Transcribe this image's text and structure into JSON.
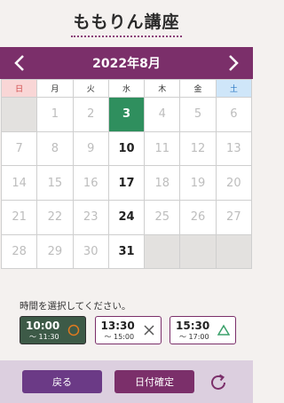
{
  "page": {
    "title": "ももりん講座"
  },
  "calendar": {
    "month_label": "2022年8月",
    "weekdays": [
      "日",
      "月",
      "火",
      "水",
      "木",
      "金",
      "土"
    ],
    "weeks": [
      [
        "",
        "1",
        "2",
        "3",
        "4",
        "5",
        "6"
      ],
      [
        "7",
        "8",
        "9",
        "10",
        "11",
        "12",
        "13"
      ],
      [
        "14",
        "15",
        "16",
        "17",
        "18",
        "19",
        "20"
      ],
      [
        "21",
        "22",
        "23",
        "24",
        "25",
        "26",
        "27"
      ],
      [
        "28",
        "29",
        "30",
        "31",
        "",
        "",
        ""
      ]
    ],
    "selected_day": "3",
    "available_days": [
      "3",
      "10",
      "17",
      "24",
      "31"
    ],
    "colors": {
      "header": "#7b2f6a",
      "selected": "#2f8f5e",
      "sunday": "#f9d6d6",
      "saturday": "#cfe6f9"
    }
  },
  "time_select": {
    "prompt": "時間を選択してください。",
    "slots": [
      {
        "start": "10:00",
        "end": "〜 11:30",
        "mark_icon": "circle-icon",
        "active": true
      },
      {
        "start": "13:30",
        "end": "〜 15:00",
        "mark_icon": "cross-icon",
        "active": false
      },
      {
        "start": "15:30",
        "end": "〜 17:00",
        "mark_icon": "triangle-icon",
        "active": false
      }
    ]
  },
  "footer": {
    "back_label": "戻る",
    "confirm_label": "日付確定",
    "refresh_icon": "refresh-icon"
  }
}
